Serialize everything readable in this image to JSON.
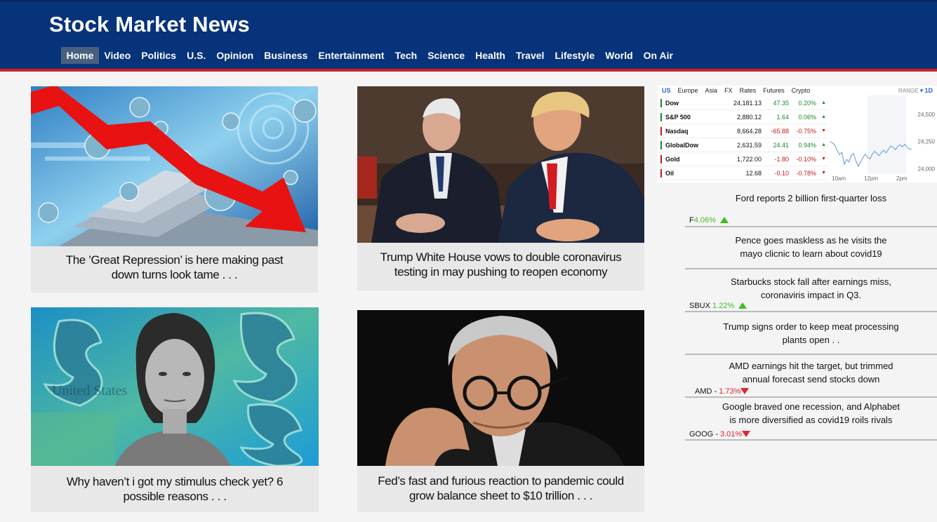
{
  "site": {
    "title": "Stock Market News"
  },
  "nav": [
    "Home",
    "Video",
    "Politics",
    "U.S.",
    "Opinion",
    "Business",
    "Entertainment",
    "Tech",
    "Science",
    "Health",
    "Travel",
    "Lifestyle",
    "World",
    "On Air"
  ],
  "articles": [
    {
      "caption_line1": "The ’Great Repression’ is here making past",
      "caption_line2": "down turns look tame . . .",
      "image": "falling-red-arrow-virus-illustration"
    },
    {
      "caption_line1": "Trump White House vows to double coronavirus",
      "caption_line2": "testing in may pushing to reopen economy",
      "image": "trump-pence-meeting-photo"
    },
    {
      "caption_line1": "Why haven’t i got my stimulus check yet? 6",
      "caption_line2": "possible reasons . . .",
      "image": "woman-dollar-signs-collage"
    },
    {
      "caption_line1": "Fed’s fast and furious reaction to pandemic could",
      "caption_line2": "grow balance sheet to $10 trillion . . .",
      "image": "fed-chair-glasses-photo"
    }
  ],
  "ticker": {
    "tabs": [
      "US",
      "Europe",
      "Asia",
      "FX",
      "Rates",
      "Futures",
      "Crypto"
    ],
    "range_label": "RANGE",
    "range_value": "1D",
    "rows": [
      {
        "name": "Dow",
        "value": "24,181.13",
        "change": "47.35",
        "pct": "0.20%",
        "dir": "up"
      },
      {
        "name": "S&P 500",
        "value": "2,880.12",
        "change": "1.64",
        "pct": "0.06%",
        "dir": "up"
      },
      {
        "name": "Nasdaq",
        "value": "8,664.28",
        "change": "-65.88",
        "pct": "-0.75%",
        "dir": "down"
      },
      {
        "name": "GlobalDow",
        "value": "2,631.59",
        "change": "24.41",
        "pct": "0.94%",
        "dir": "up"
      },
      {
        "name": "Gold",
        "value": "1,722.00",
        "change": "-1.80",
        "pct": "-0.10%",
        "dir": "down"
      },
      {
        "name": "Oil",
        "value": "12.68",
        "change": "-0.10",
        "pct": "-0.78%",
        "dir": "down"
      }
    ],
    "chart_data": {
      "type": "line",
      "x_ticks": [
        "10am",
        "12pm",
        "2pm"
      ],
      "y_ticks": [
        "24,500",
        "24,250",
        "24,000"
      ],
      "ylim": [
        23950,
        24650
      ],
      "values": [
        24250,
        24235,
        24215,
        24165,
        24130,
        24150,
        24040,
        24085,
        24060,
        24120,
        24140,
        24070,
        24020,
        24060,
        24100,
        24135,
        24105,
        24090,
        24130,
        24160,
        24140,
        24120,
        24150,
        24170,
        24145,
        24180,
        24210,
        24195,
        24175,
        24205,
        24220,
        24200,
        24225,
        24195,
        24180,
        24181
      ]
    }
  },
  "headlines": [
    {
      "line1": "Ford reports 2 billion first-quarter loss",
      "line2": "",
      "symbol": "F",
      "change": "4.06%",
      "dir": "up"
    },
    {
      "line1": "Pence goes maskless as he visits the",
      "line2": "mayo clicnic to learn about covid19",
      "symbol": "",
      "change": "",
      "dir": ""
    },
    {
      "line1": "Starbucks stock fall after earnings miss,",
      "line2": "coronaviris impact in Q3.",
      "symbol": "SBUX",
      "change": "1.22%",
      "dir": "up"
    },
    {
      "line1": "Trump signs order to keep meat processing",
      "line2": "plants open . .",
      "symbol": "",
      "change": "",
      "dir": ""
    },
    {
      "line1": "AMD earnings hit the target, but trimmed",
      "line2": "annual forecast send stocks down",
      "symbol": "AMD - ",
      "change": "1.73%",
      "dir": "down"
    },
    {
      "line1": "Google braved one recession, and Alphabet",
      "line2": "is more diversified as covid19 roils rivals",
      "symbol": "GOOG - ",
      "change": "3.01%",
      "dir": "down"
    }
  ],
  "colors": {
    "header": "#06337a",
    "accent_red": "#d0202c",
    "up": "#3fbf1f",
    "down": "#e0262e"
  }
}
